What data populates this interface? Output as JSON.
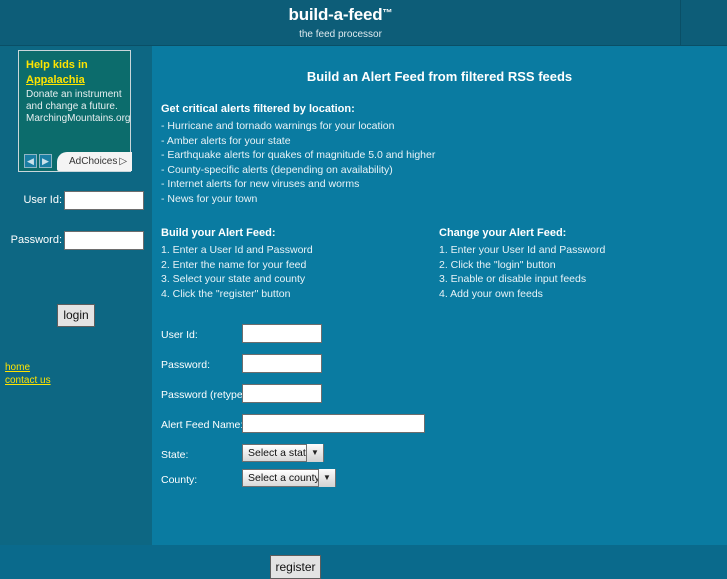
{
  "header": {
    "brand": "build-a-feed",
    "trademark": "™",
    "tagline": "the feed processor"
  },
  "sidebar": {
    "ad": {
      "headline": "Help kids in",
      "link_text": "Appalachia",
      "desc_line1": "Donate an instrument",
      "desc_line2": "and change a future.",
      "desc_line3": "MarchingMountains.org",
      "prev_arrow": "◀",
      "next_arrow": "▶",
      "adchoices_label": "AdChoices",
      "adchoices_triangle": "▷"
    },
    "login": {
      "user_label": "User Id:",
      "user_value": "",
      "password_label": "Password:",
      "password_value": "",
      "button_label": "login"
    },
    "links": [
      {
        "label": "home"
      },
      {
        "label": "contact us"
      }
    ]
  },
  "main": {
    "heading": "Build an Alert Feed from filtered RSS feeds",
    "alerts": {
      "title": "Get critical alerts filtered by location:",
      "items": [
        "- Hurricane and tornado warnings for your location",
        "- Amber alerts for your state",
        "- Earthquake alerts for quakes of magnitude 5.0 and higher",
        "- County-specific alerts (depending on availability)",
        "- Internet alerts for new viruses and worms",
        "- News for your town"
      ]
    },
    "build": {
      "title": "Build your Alert Feed:",
      "items": [
        "1. Enter a User Id and Password",
        "2. Enter the name for your feed",
        "3. Select your state and county",
        "4. Click the \"register\" button"
      ]
    },
    "change": {
      "title": "Change your Alert Feed:",
      "items": [
        "1. Enter your User Id and Password",
        "2. Click the \"login\" button",
        "3. Enable or disable input feeds",
        "4. Add your own feeds"
      ]
    },
    "register_form": {
      "user_label": "User Id:",
      "user_value": "",
      "password_label": "Password:",
      "password_value": "",
      "password_retype_label": "Password (retype):",
      "password_retype_value": "",
      "feed_name_label": "Alert Feed Name:",
      "feed_name_value": "",
      "state_label": "State:",
      "state_selected": "Select a state",
      "county_label": "County:",
      "county_selected": "Select a county",
      "dropdown_arrow": "▼",
      "submit_label": "register"
    }
  },
  "colors": {
    "header_bg": "#0d5d78",
    "sidebar_bg": "#0d6783",
    "main_bg": "#0a7ba1",
    "ad_bg": "#0c6c6c",
    "accent_yellow": "#ffe400"
  }
}
